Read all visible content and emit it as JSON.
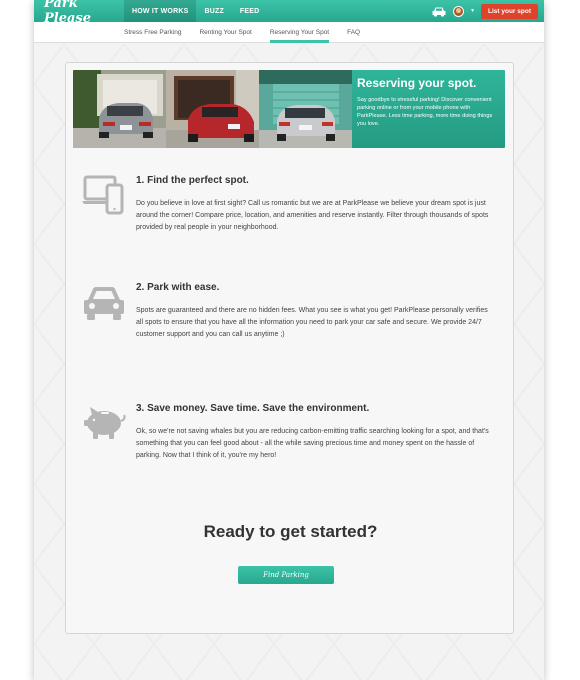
{
  "header": {
    "logo": "Park Please",
    "nav": [
      "HOW IT WORKS",
      "BUZZ",
      "FEED"
    ],
    "list_button": "List your spot",
    "accent": "#2fb59a",
    "button_color": "#e0432b"
  },
  "subnav": {
    "items": [
      "Stress Free Parking",
      "Renting Your Spot",
      "Reserving Your Spot",
      "FAQ"
    ],
    "active": "Reserving Your Spot"
  },
  "banner": {
    "title": "Reserving your spot.",
    "body": "Say goodbye to stressful parking! Discover convenient parking online or from your mobile phone with ParkPlease. Less time parking, more time doing things you love."
  },
  "sections": [
    {
      "icon": "devices-icon",
      "title": "1. Find the perfect spot.",
      "body": "Do you believe in love at first sight? Call us romantic but we are at ParkPlease we believe your dream spot is just around the corner! Compare price, location, and amenities and reserve instantly. Filter through thousands of spots provided by real people in your neighborhood."
    },
    {
      "icon": "car-icon",
      "title": "2. Park with ease.",
      "body": "Spots are guaranteed and there are no hidden fees. What you see is what you get! ParkPlease personally verifies all spots to ensure that you have all the information you need to park your car safe and secure. We provide 24/7 customer support and you can call us anytime ;)"
    },
    {
      "icon": "piggy-bank-icon",
      "title": "3. Save money. Save time. Save the environment.",
      "body": "Ok, so we're not saving whales but you are reducing carbon-emitting traffic searching looking for a spot, and that's something that you can feel good about - all the while saving precious time and money spent on the hassle of parking. Now that I think of it, you're my hero!"
    }
  ],
  "cta": {
    "title": "Ready to get started?",
    "button": "Find Parking"
  }
}
